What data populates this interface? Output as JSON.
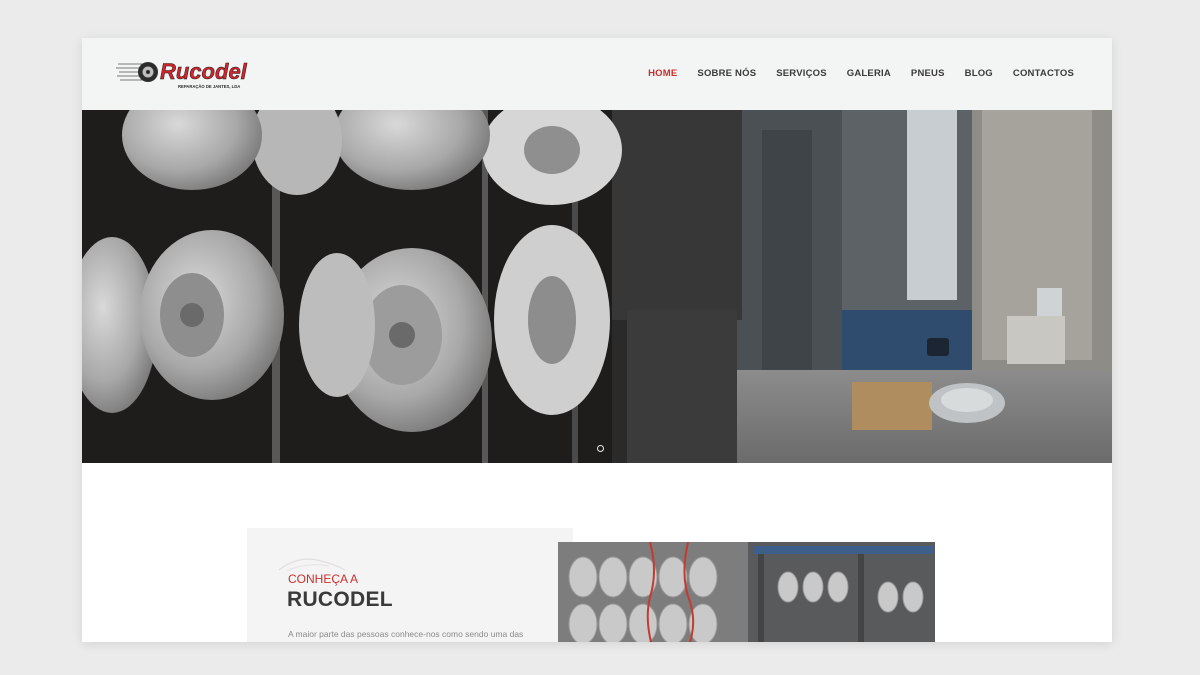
{
  "brand": {
    "name": "Rucodel",
    "tagline": "REPARAÇÃO DE JANTES, LDA",
    "accent": "#c8302c"
  },
  "nav": {
    "items": [
      {
        "label": "HOME",
        "active": true
      },
      {
        "label": "SOBRE NÓS",
        "active": false
      },
      {
        "label": "SERVIÇOS",
        "active": false
      },
      {
        "label": "GALERIA",
        "active": false
      },
      {
        "label": "PNEUS",
        "active": false
      },
      {
        "label": "BLOG",
        "active": false
      },
      {
        "label": "CONTACTOS",
        "active": false
      }
    ]
  },
  "hero": {
    "slides_total": 1,
    "current_slide": 1
  },
  "about": {
    "kicker": "CONHEÇA A",
    "title": "RUCODEL",
    "text": "A maior parte das pessoas conhece-nos como sendo uma das"
  },
  "icons": {
    "logo": "tire-icon",
    "slider": "slider-dot-icon"
  }
}
